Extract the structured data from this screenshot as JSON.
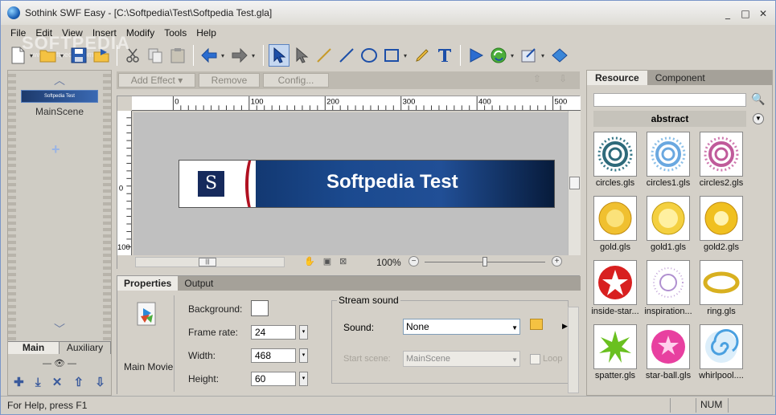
{
  "window": {
    "title": "Sothink SWF Easy - [C:\\Softpedia\\Test\\Softpedia Test.gla]",
    "controls": [
      "_",
      "□",
      "✕"
    ]
  },
  "watermark": {
    "text": "SOFTPEDIA",
    "sub": "www.softpedia.com"
  },
  "menu": [
    "File",
    "Edit",
    "View",
    "Insert",
    "Modify",
    "Tools",
    "Help"
  ],
  "toolbar": {
    "icons": [
      "new-document-icon",
      "open-folder-icon",
      "save-icon",
      "publish-icon",
      "cut-icon",
      "copy-icon",
      "paste-icon",
      "undo-icon",
      "redo-icon",
      "select-arrow-icon",
      "subselect-icon",
      "pencil-line-icon",
      "line-icon",
      "ellipse-icon",
      "rectangle-icon",
      "brush-icon",
      "text-icon",
      "play-icon",
      "refresh-icon",
      "export-icon",
      "fill-icon"
    ]
  },
  "left": {
    "scene_thumb_text": "Softpedia Test",
    "scene_name": "MainScene",
    "tabs": [
      "Main",
      "Auxiliary"
    ],
    "add_glyph": "+"
  },
  "effects": {
    "add": "Add Effect",
    "remove": "Remove",
    "config": "Config..."
  },
  "stage": {
    "banner_title": "Softpedia Test",
    "banner_logo": "S",
    "ruler_labels": [
      "0",
      "100",
      "200",
      "300",
      "400",
      "500"
    ],
    "vruler_labels": [
      "0",
      "100"
    ],
    "zoom": "100%"
  },
  "properties": {
    "tabs": [
      "Properties",
      "Output"
    ],
    "movie_label": "Main Movie",
    "background_label": "Background:",
    "frame_rate_label": "Frame rate:",
    "frame_rate": "24",
    "width_label": "Width:",
    "width": "468",
    "height_label": "Height:",
    "height": "60",
    "stream_sound": "Stream sound",
    "sound_label": "Sound:",
    "sound_value": "None",
    "start_scene_label": "Start scene:",
    "start_scene_value": "MainScene",
    "loop_label": "Loop"
  },
  "resource": {
    "tabs": [
      "Resource",
      "Component"
    ],
    "category": "abstract",
    "items": [
      {
        "name": "circles.gls",
        "icon": "circles-icon"
      },
      {
        "name": "circles1.gls",
        "icon": "circles1-icon"
      },
      {
        "name": "circles2.gls",
        "icon": "circles2-icon"
      },
      {
        "name": "gold.gls",
        "icon": "gold-icon"
      },
      {
        "name": "gold1.gls",
        "icon": "gold1-icon"
      },
      {
        "name": "gold2.gls",
        "icon": "gold2-icon"
      },
      {
        "name": "inside-star...",
        "icon": "inside-star-icon"
      },
      {
        "name": "inspiration...",
        "icon": "inspiration-icon"
      },
      {
        "name": "ring.gls",
        "icon": "ring-icon"
      },
      {
        "name": "spatter.gls",
        "icon": "spatter-icon"
      },
      {
        "name": "star-ball.gls",
        "icon": "star-ball-icon"
      },
      {
        "name": "whirlpool....",
        "icon": "whirlpool-icon"
      }
    ]
  },
  "status": {
    "text": "For Help, press F1",
    "num": "NUM"
  },
  "colors": {
    "accent": "#1b4a8f",
    "banner_red": "#b01020",
    "panel": "#d4d0c8"
  }
}
